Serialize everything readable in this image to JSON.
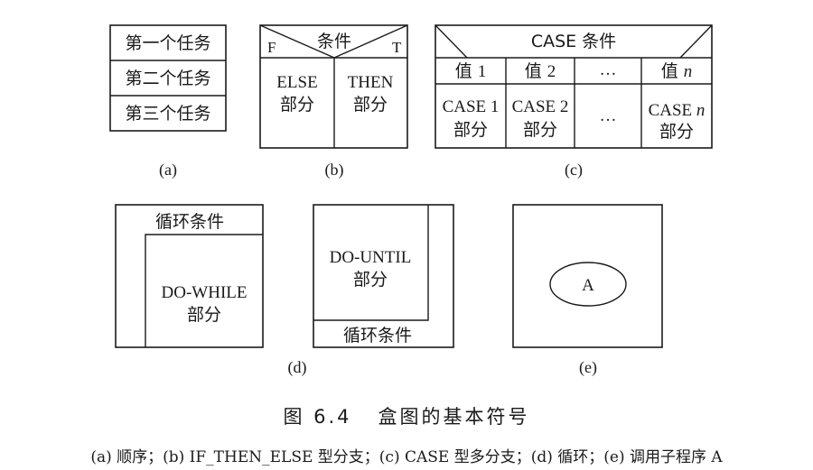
{
  "fig_a": {
    "rows": [
      "第一个任务",
      "第二个任务",
      "第三个任务"
    ],
    "label": "(a)"
  },
  "fig_b": {
    "condition": "条件",
    "false_mark": "F",
    "true_mark": "T",
    "else_line1": "ELSE",
    "else_line2": "部分",
    "then_line1": "THEN",
    "then_line2": "部分",
    "label": "(b)"
  },
  "fig_c": {
    "header": "CASE 条件",
    "values": [
      {
        "prefix": "值 ",
        "num": "1"
      },
      {
        "prefix": "值 ",
        "num": "2"
      },
      {
        "prefix": "",
        "num": "…"
      },
      {
        "prefix": "值 ",
        "num": "n"
      }
    ],
    "cases": [
      {
        "line1": "CASE 1",
        "line2": "部分"
      },
      {
        "line1": "CASE 2",
        "line2": "部分"
      },
      {
        "line1": "…",
        "line2": ""
      },
      {
        "line1": "CASE ",
        "italic": "n",
        "line2": "部分"
      }
    ],
    "label": "(c)"
  },
  "fig_d": {
    "condition": "循环条件",
    "body_line1": "DO-WHILE",
    "body_line2": "部分",
    "label": "(d)"
  },
  "fig_d2": {
    "body_line1": "DO-UNTIL",
    "body_line2": "部分",
    "condition": "循环条件"
  },
  "fig_e": {
    "call": "A",
    "label": "(e)"
  },
  "title": "图 6.4   盒图的基本符号",
  "caption": "(a) 顺序；(b) IF_THEN_ELSE 型分支；(c) CASE 型多分支；(d) 循环；(e) 调用子程序 A"
}
